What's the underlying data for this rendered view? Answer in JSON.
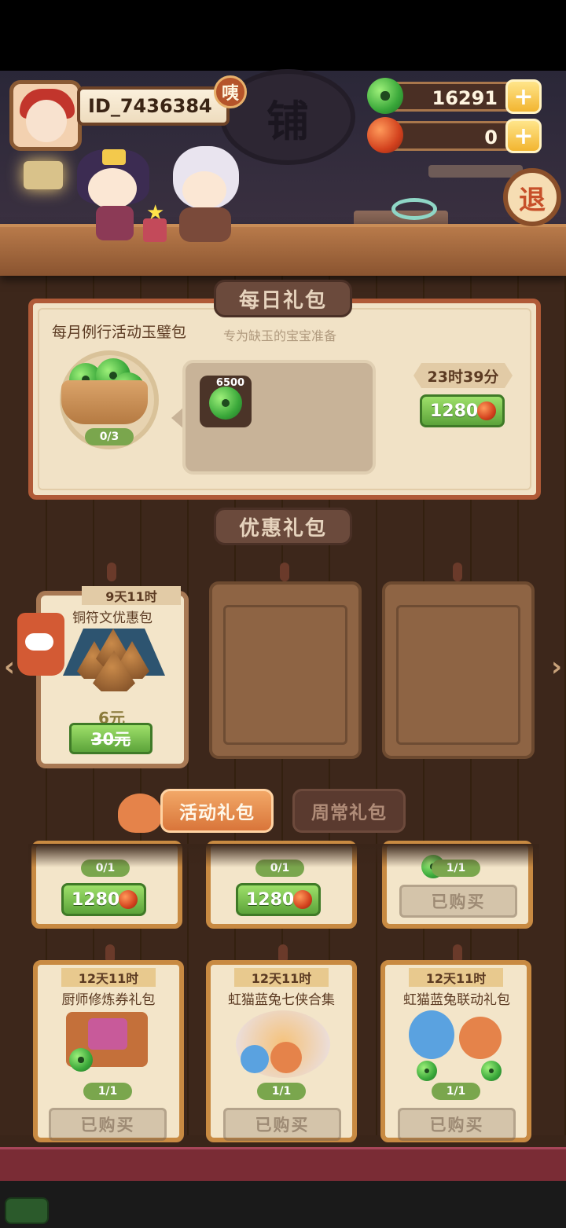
{
  "header": {
    "player_id": "ID_7436384",
    "copy_badge": "咦",
    "shop_sign": "铺",
    "exit_label": "退",
    "currencies": [
      {
        "name": "green-jade",
        "value": "16291",
        "color": "#3aa83a"
      },
      {
        "name": "red-jade",
        "value": "0",
        "color": "#d3421e"
      }
    ],
    "plus_label": "+"
  },
  "daily": {
    "section_title": "每日礼包",
    "pack_name": "每月例行活动玉璧包",
    "subtitle": "专为缺玉的宝宝准备",
    "progress": "0/3",
    "reward_qty": "6500",
    "timer": "23时39分",
    "price": "1280"
  },
  "discount": {
    "section_title": "优惠礼包",
    "pack": {
      "timer": "9天11时",
      "name": "铜符文优惠包",
      "sale_price": "6元",
      "original_price": "30元"
    },
    "left_arrow": "‹",
    "right_arrow": "›"
  },
  "tabs": {
    "active": "活动礼包",
    "inactive": "周常礼包"
  },
  "activity_top_row": [
    {
      "qty": "0/1",
      "price": "1280"
    },
    {
      "qty": "0/1",
      "price": "1280"
    },
    {
      "qty": "1/1",
      "status": "已购买"
    }
  ],
  "activity_bottom_row": [
    {
      "timer": "12天11时",
      "name": "厨师修炼券礼包",
      "qty": "1/1",
      "status": "已购买"
    },
    {
      "timer": "12天11时",
      "name": "虹猫蓝兔七侠合集",
      "qty": "1/1",
      "status": "已购买"
    },
    {
      "timer": "12天11时",
      "name": "虹猫蓝兔联动礼包",
      "qty": "1/1",
      "status": "已购买"
    }
  ],
  "colors": {
    "accent_orange": "#d9753a",
    "price_green": "#5ca33a",
    "card_border": "#b05a37"
  }
}
